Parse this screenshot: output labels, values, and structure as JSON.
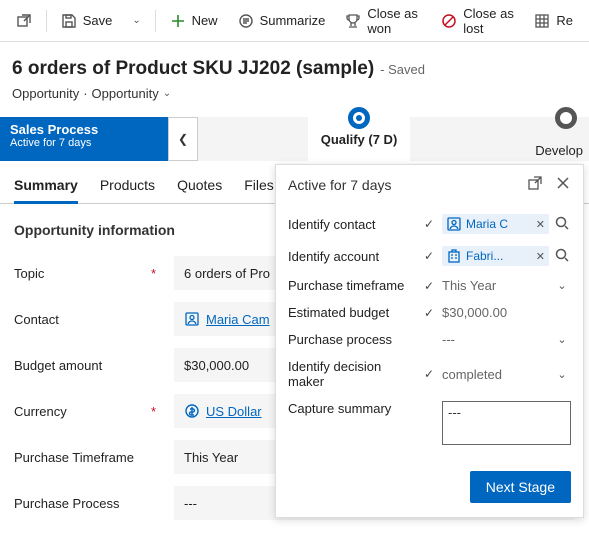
{
  "toolbar": {
    "save": "Save",
    "new": "New",
    "summarize": "Summarize",
    "closeWon": "Close as won",
    "closeLost": "Close as lost",
    "recalc": "Re"
  },
  "header": {
    "title": "6 orders of Product SKU JJ202 (sample)",
    "saved": "- Saved",
    "entity": "Opportunity",
    "form": "Opportunity"
  },
  "process": {
    "name": "Sales Process",
    "activeFor": "Active for 7 days",
    "qualify": "Qualify  (7 D)",
    "develop": "Develop"
  },
  "tabs": {
    "summary": "Summary",
    "products": "Products",
    "quotes": "Quotes",
    "files": "Files"
  },
  "section": {
    "title": "Opportunity information"
  },
  "fields": {
    "topic": {
      "label": "Topic",
      "value": "6 orders of Pro"
    },
    "contact": {
      "label": "Contact",
      "value": "Maria Cam"
    },
    "budget": {
      "label": "Budget amount",
      "value": "$30,000.00"
    },
    "currency": {
      "label": "Currency",
      "value": "US Dollar"
    },
    "timeframe": {
      "label": "Purchase Timeframe",
      "value": "This Year"
    },
    "purchaseProcess": {
      "label": "Purchase Process",
      "value": "---"
    }
  },
  "flyout": {
    "active": "Active for 7 days",
    "rows": {
      "contact": {
        "label": "Identify contact",
        "value": "Maria C"
      },
      "account": {
        "label": "Identify account",
        "value": "Fabri..."
      },
      "timeframe": {
        "label": "Purchase timeframe",
        "value": "This Year"
      },
      "budget": {
        "label": "Estimated budget",
        "value": "$30,000.00"
      },
      "process": {
        "label": "Purchase process",
        "value": "---"
      },
      "decision": {
        "label": "Identify decision maker",
        "value": "completed"
      },
      "summary": {
        "label": "Capture summary",
        "value": "---"
      }
    },
    "button": "Next Stage"
  }
}
